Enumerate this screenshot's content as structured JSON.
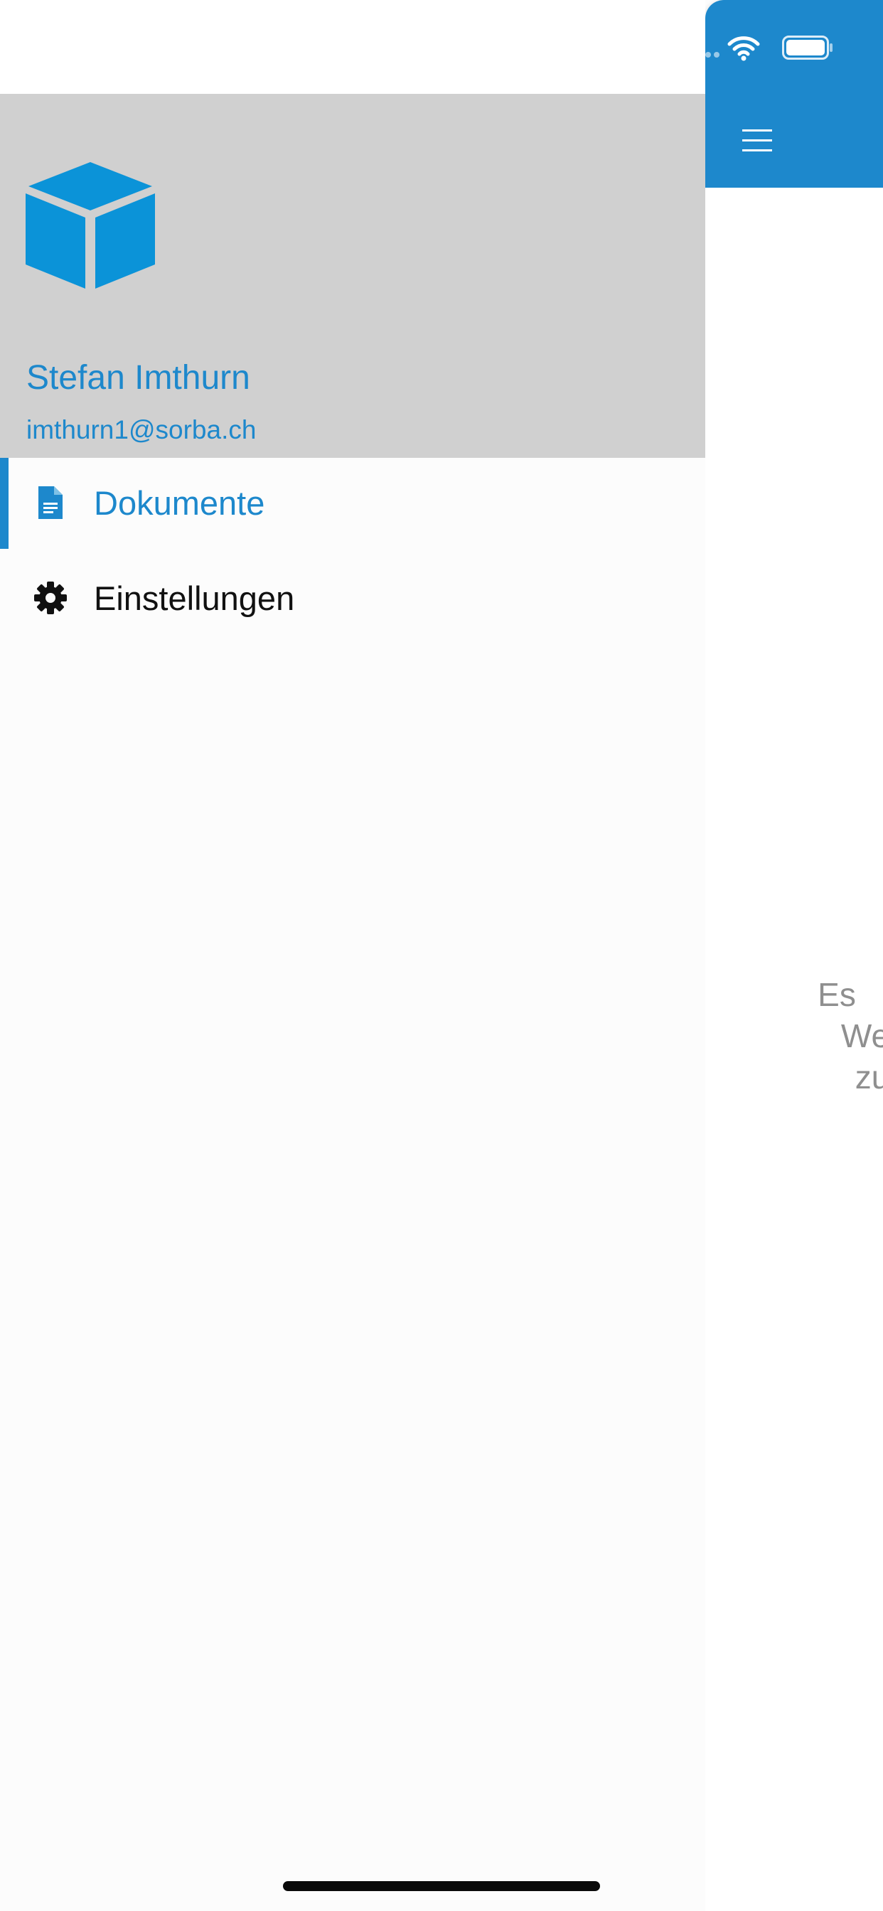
{
  "status_bar": {
    "wifi_icon": "wifi-icon",
    "battery_icon": "battery-icon"
  },
  "main": {
    "menu_icon": "hamburger-menu-icon",
    "empty_message_lines": [
      "Es",
      "We",
      "zu"
    ]
  },
  "drawer": {
    "logo_icon": "cube-icon",
    "user": {
      "name": "Stefan Imthurn",
      "email": "imthurn1@sorba.ch"
    },
    "items": [
      {
        "label": "Dokumente",
        "icon": "document-icon",
        "active": true
      },
      {
        "label": "Einstellungen",
        "icon": "gear-icon",
        "active": false
      }
    ]
  },
  "colors": {
    "accent": "#1d88cc",
    "logo": "#0b93d8",
    "header_bg": "#d0d0d0",
    "muted_text": "#8f8f8f"
  }
}
